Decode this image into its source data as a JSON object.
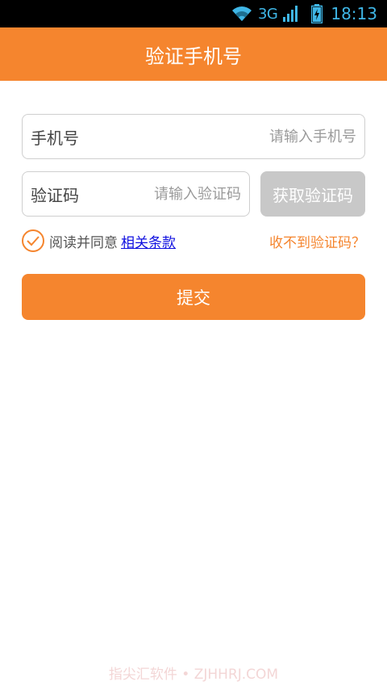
{
  "status_bar": {
    "network": "3G",
    "time": "18:13",
    "icons": [
      "wifi-icon",
      "signal-icon",
      "battery-charging-icon"
    ]
  },
  "header": {
    "title": "验证手机号"
  },
  "phone_field": {
    "label": "手机号",
    "placeholder": "请输入手机号"
  },
  "code_field": {
    "label": "验证码",
    "placeholder": "请输入验证码"
  },
  "get_code_button": {
    "label": "获取验证码"
  },
  "agreement": {
    "checked": true,
    "text": "阅读并同意",
    "terms_link": "相关条款"
  },
  "no_code_link": "收不到验证码？",
  "submit_button": {
    "label": "提交"
  },
  "watermark": "指尖汇软件 • ZJHHRJ.COM",
  "colors": {
    "accent": "#f5852e",
    "disabled_button": "#c8c8c8",
    "link": "#1010e0",
    "status_icon": "#3fb6e6"
  }
}
